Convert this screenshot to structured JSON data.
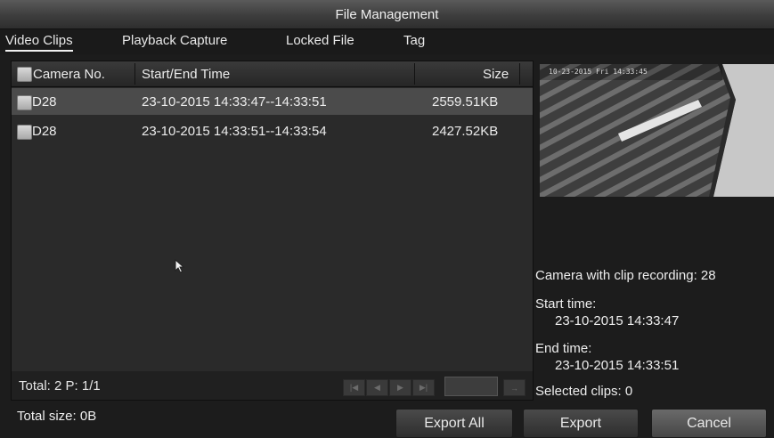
{
  "window": {
    "title": "File Management"
  },
  "tabs": [
    {
      "label": "Video Clips",
      "active": true
    },
    {
      "label": "Playback Capture",
      "active": false
    },
    {
      "label": "Locked File",
      "active": false
    },
    {
      "label": "Tag",
      "active": false
    }
  ],
  "table": {
    "columns": [
      "Camera No.",
      "Start/End Time",
      "Size"
    ],
    "rows": [
      {
        "camera": "D28",
        "time": "23-10-2015 14:33:47--14:33:51",
        "size": "2559.51KB",
        "selected": true
      },
      {
        "camera": "D28",
        "time": "23-10-2015 14:33:51--14:33:54",
        "size": "2427.52KB",
        "selected": false
      }
    ]
  },
  "pagination": {
    "summary": "Total: 2  P: 1/1",
    "page_value": "",
    "buttons": [
      "first-page-icon",
      "previous-page-icon",
      "next-page-icon",
      "last-page-icon",
      "go-arrow-icon"
    ]
  },
  "preview": {
    "osd_text": "10-23-2015 Fri 14:33:45"
  },
  "clip_info": {
    "camera_line": "Camera with clip recording: 28",
    "start_label": "Start time:",
    "start_value": "23-10-2015 14:33:47",
    "end_label": "End time:",
    "end_value": "23-10-2015 14:33:51",
    "selected_line": "Selected clips: 0"
  },
  "footer": {
    "total_size": "Total size: 0B"
  },
  "buttons": {
    "export_all": "Export All",
    "export": "Export",
    "cancel": "Cancel"
  },
  "colors": {
    "background": "#1c1c1c",
    "selected_row": "#4b4b4b",
    "title_bar": "#4a4a4a"
  }
}
